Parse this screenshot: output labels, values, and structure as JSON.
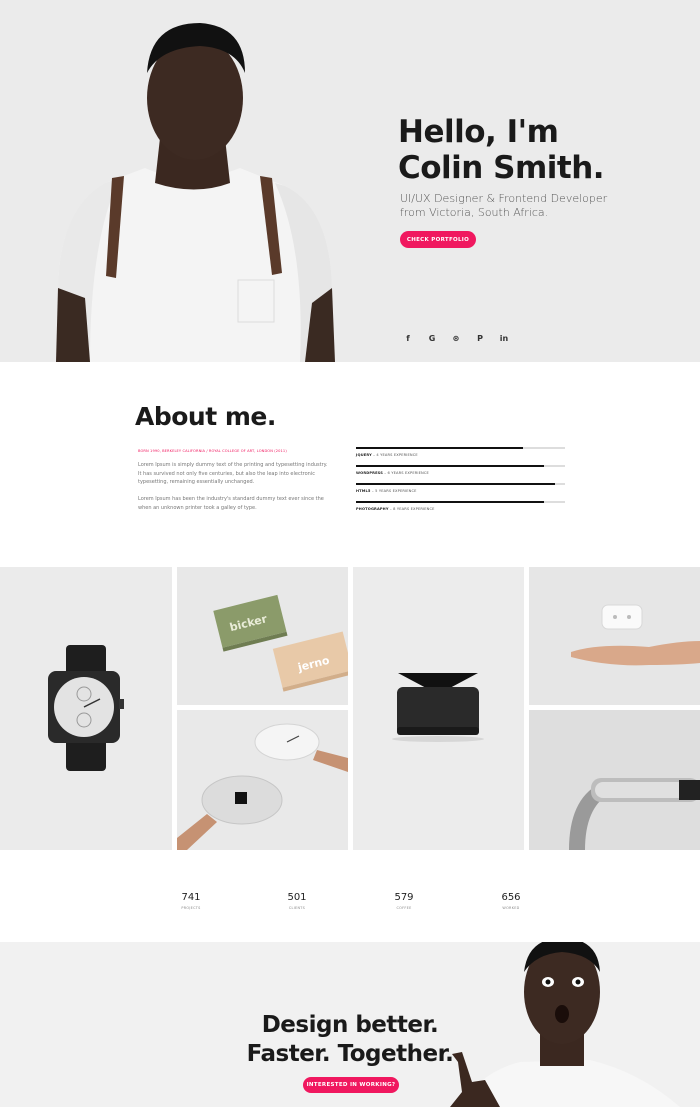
{
  "hero": {
    "title_line1": "Hello, I'm",
    "title_line2": "Colin Smith.",
    "subtitle_line1": "UI/UX Designer & Frontend Developer",
    "subtitle_line2": "from Victoria, South Africa.",
    "cta_label": "CHECK PORTFOLIO",
    "social": [
      {
        "icon": "facebook-icon",
        "glyph": "f"
      },
      {
        "icon": "google-icon",
        "glyph": "G"
      },
      {
        "icon": "dribbble-icon",
        "glyph": "⊛"
      },
      {
        "icon": "pinterest-icon",
        "glyph": "P"
      },
      {
        "icon": "linkedin-icon",
        "glyph": "in"
      }
    ]
  },
  "about": {
    "title": "About me.",
    "meta": "BORN 1990, BERKELEY CALIFORNIA / ROYAL COLLEGE OF ART, LONDON (2011)",
    "paragraph1": "Lorem Ipsum is simply dummy text of the printing and typesetting industry. It has survived not only five centuries, but also the leap into electronic typesetting, remaining essentially unchanged.",
    "paragraph2": "Lorem Ipsum has been the industry's standard dummy text ever since the when an unknown printer took a galley of type.",
    "skills": [
      {
        "name": "JQUERY",
        "detail": "– 4 YEARS EXPERIENCE",
        "level": 0.8
      },
      {
        "name": "WORDPRESS",
        "detail": "– 6 YEARS EXPERIENCE",
        "level": 0.9
      },
      {
        "name": "HTML5",
        "detail": "– 5 YEARS EXPERIENCE",
        "level": 0.95
      },
      {
        "name": "PHOTOGRAPHY",
        "detail": "– 8 YEARS EXPERIENCE",
        "level": 0.9
      }
    ]
  },
  "portfolio": {
    "items": [
      {
        "name": "watch"
      },
      {
        "name": "business-cards",
        "text1": "bicker",
        "text2": "jerno"
      },
      {
        "name": "wall-clock"
      },
      {
        "name": "speaker"
      },
      {
        "name": "remote-in-hand"
      },
      {
        "name": "watch-band"
      }
    ]
  },
  "stats": [
    {
      "value": "741",
      "label": "PROJECTS"
    },
    {
      "value": "501",
      "label": "CLIENTS"
    },
    {
      "value": "579",
      "label": "COFFEE"
    },
    {
      "value": "656",
      "label": "WORKED"
    }
  ],
  "cta": {
    "title_line1": "Design better.",
    "title_line2": "Faster. Together.",
    "button_label": "INTERESTED IN WORKING?"
  },
  "colors": {
    "accent": "#f0185f",
    "hero_bg": "#ebebeb",
    "tile_bg": "#e5e5e5"
  }
}
